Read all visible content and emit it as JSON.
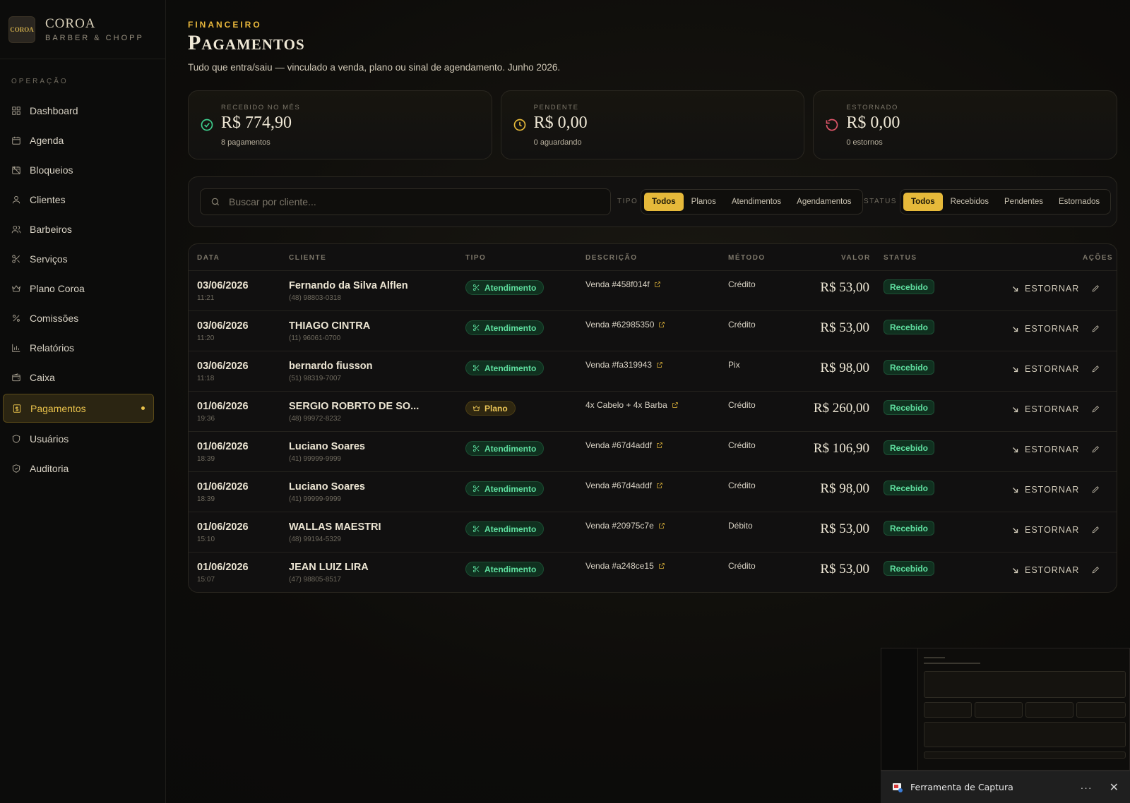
{
  "brand": {
    "logo_text": "COROA",
    "name": "COROA",
    "sub": "BARBER & CHOPP"
  },
  "sidebar": {
    "section": "OPERAÇÃO",
    "items": [
      {
        "label": "Dashboard",
        "icon": "dashboard-icon"
      },
      {
        "label": "Agenda",
        "icon": "calendar-icon"
      },
      {
        "label": "Bloqueios",
        "icon": "calendar-off-icon"
      },
      {
        "label": "Clientes",
        "icon": "user-icon"
      },
      {
        "label": "Barbeiros",
        "icon": "users-icon"
      },
      {
        "label": "Serviços",
        "icon": "scissors-icon"
      },
      {
        "label": "Plano Coroa",
        "icon": "crown-icon"
      },
      {
        "label": "Comissões",
        "icon": "percent-icon"
      },
      {
        "label": "Relatórios",
        "icon": "bar-chart-icon"
      },
      {
        "label": "Caixa",
        "icon": "wallet-icon"
      },
      {
        "label": "Pagamentos",
        "icon": "receipt-icon",
        "active": true
      },
      {
        "label": "Usuários",
        "icon": "shield-icon"
      },
      {
        "label": "Auditoria",
        "icon": "shield-check-icon"
      }
    ]
  },
  "header": {
    "eyebrow": "FINANCEIRO",
    "title": "Pagamentos",
    "subtitle": "Tudo que entra/saiu — vinculado a venda, plano ou sinal de agendamento. Junho 2026."
  },
  "cards": [
    {
      "label": "RECEBIDO NO MÊS",
      "value": "R$ 774,90",
      "sub": "8 pagamentos",
      "icon": "check-circle-icon",
      "color": "#3ecf8e"
    },
    {
      "label": "PENDENTE",
      "value": "R$ 0,00",
      "sub": "0 aguardando",
      "icon": "clock-icon",
      "color": "#e6b93a"
    },
    {
      "label": "ESTORNADO",
      "value": "R$ 0,00",
      "sub": "0 estornos",
      "icon": "rotate-ccw-icon",
      "color": "#e0566a"
    }
  ],
  "filters": {
    "search_placeholder": "Buscar por cliente...",
    "tipo_label": "TIPO",
    "tipo_options": [
      "Todos",
      "Planos",
      "Atendimentos",
      "Agendamentos"
    ],
    "status_label": "STATUS",
    "status_options": [
      "Todos",
      "Recebidos",
      "Pendentes",
      "Estornados"
    ]
  },
  "table": {
    "headers": {
      "data": "DATA",
      "cliente": "CLIENTE",
      "tipo": "TIPO",
      "descricao": "DESCRIÇÃO",
      "metodo": "MÉTODO",
      "valor": "VALOR",
      "status": "STATUS",
      "acoes": "AÇÕES"
    },
    "action_label": "ESTORNAR",
    "rows": [
      {
        "date": "03/06/2026",
        "time": "11:21",
        "client": "Fernando da Silva Alflen",
        "phone": "(48) 98803-0318",
        "type": "Atendimento",
        "kind": "at",
        "desc": "Venda #458f014f",
        "method": "Crédito",
        "value": "R$ 53,00",
        "status": "Recebido"
      },
      {
        "date": "03/06/2026",
        "time": "11:20",
        "client": "THIAGO CINTRA",
        "phone": "(11) 96061-0700",
        "type": "Atendimento",
        "kind": "at",
        "desc": "Venda #62985350",
        "method": "Crédito",
        "value": "R$ 53,00",
        "status": "Recebido"
      },
      {
        "date": "03/06/2026",
        "time": "11:18",
        "client": "bernardo fiusson",
        "phone": "(51) 98319-7007",
        "type": "Atendimento",
        "kind": "at",
        "desc": "Venda #fa319943",
        "method": "Pix",
        "value": "R$ 98,00",
        "status": "Recebido"
      },
      {
        "date": "01/06/2026",
        "time": "19:36",
        "client": "SERGIO ROBRTO DE SO...",
        "phone": "(48) 99972-8232",
        "type": "Plano",
        "kind": "pl",
        "desc": "4x Cabelo + 4x Barba",
        "method": "Crédito",
        "value": "R$ 260,00",
        "status": "Recebido"
      },
      {
        "date": "01/06/2026",
        "time": "18:39",
        "client": "Luciano Soares",
        "phone": "(41) 99999-9999",
        "type": "Atendimento",
        "kind": "at",
        "desc": "Venda #67d4addf",
        "method": "Crédito",
        "value": "R$ 106,90",
        "status": "Recebido"
      },
      {
        "date": "01/06/2026",
        "time": "18:39",
        "client": "Luciano Soares",
        "phone": "(41) 99999-9999",
        "type": "Atendimento",
        "kind": "at",
        "desc": "Venda #67d4addf",
        "method": "Crédito",
        "value": "R$ 98,00",
        "status": "Recebido"
      },
      {
        "date": "01/06/2026",
        "time": "15:10",
        "client": "WALLAS MAESTRI",
        "phone": "(48) 99194-5329",
        "type": "Atendimento",
        "kind": "at",
        "desc": "Venda #20975c7e",
        "method": "Débito",
        "value": "R$ 53,00",
        "status": "Recebido"
      },
      {
        "date": "01/06/2026",
        "time": "15:07",
        "client": "JEAN LUIZ LIRA",
        "phone": "(47) 98805-8517",
        "type": "Atendimento",
        "kind": "at",
        "desc": "Venda #a248ce15",
        "method": "Crédito",
        "value": "R$ 53,00",
        "status": "Recebido"
      }
    ]
  },
  "snipping_tool": {
    "title": "Ferramenta de Captura",
    "more": "···",
    "close": "✕"
  }
}
